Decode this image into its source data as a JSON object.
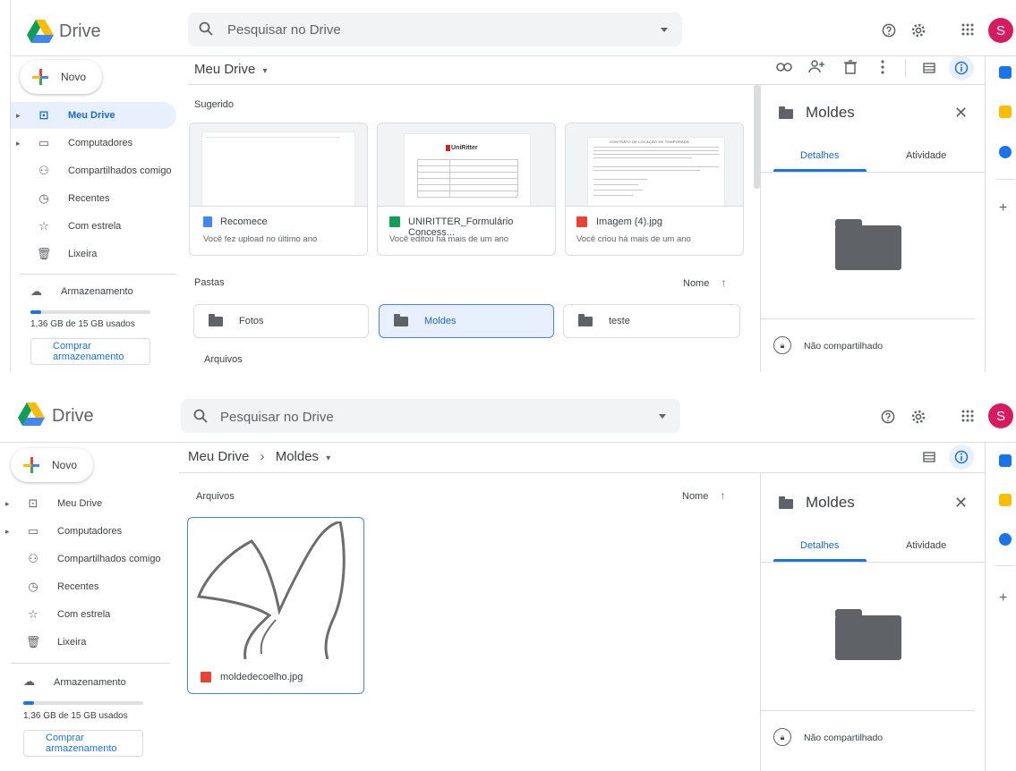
{
  "app": {
    "name": "Drive"
  },
  "search": {
    "placeholder": "Pesquisar no Drive"
  },
  "user": {
    "initial": "S"
  },
  "new_button": {
    "label": "Novo"
  },
  "sidebar": {
    "items": [
      {
        "label": "Meu Drive"
      },
      {
        "label": "Computadores"
      },
      {
        "label": "Compartilhados comigo"
      },
      {
        "label": "Recentes"
      },
      {
        "label": "Com estrela"
      },
      {
        "label": "Lixeira"
      }
    ],
    "storage": {
      "label": "Armazenamento",
      "usage": "1,36 GB de 15 GB usados",
      "used_fraction": 0.09,
      "buy_label": "Comprar armazenamento"
    }
  },
  "screen1": {
    "breadcrumb": "Meu Drive",
    "suggested_label": "Sugerido",
    "suggested": [
      {
        "name": "Recomece",
        "sub": "Você fez upload no último ano"
      },
      {
        "name": "UNIRITTER_Formulário Concess...",
        "sub": "Você editou há mais de um ano"
      },
      {
        "name": "Imagem (4).jpg",
        "sub": "Você criou há mais de um ano"
      }
    ],
    "uniritter_brand": "UniRitter",
    "contract_title": "CONTRATO DE LOCAÇÃO DE TEMPORADA",
    "folders_label": "Pastas",
    "sort_label": "Nome",
    "folders": [
      {
        "name": "Fotos"
      },
      {
        "name": "Moldes"
      },
      {
        "name": "teste"
      }
    ],
    "files_label": "Arquivos"
  },
  "screen2": {
    "breadcrumb_root": "Meu Drive",
    "breadcrumb_current": "Moldes",
    "files_label": "Arquivos",
    "sort_label": "Nome",
    "files": [
      {
        "name": "moldedecoelho.jpg"
      }
    ]
  },
  "details": {
    "title": "Moldes",
    "tab_details": "Detalhes",
    "tab_activity": "Atividade",
    "sharing": "Não compartilhado"
  },
  "colors": {
    "accent": "#1a73e8",
    "selected_bg": "#e8f0fe",
    "avatar": "#d81b60",
    "folder": "#5f6368"
  }
}
